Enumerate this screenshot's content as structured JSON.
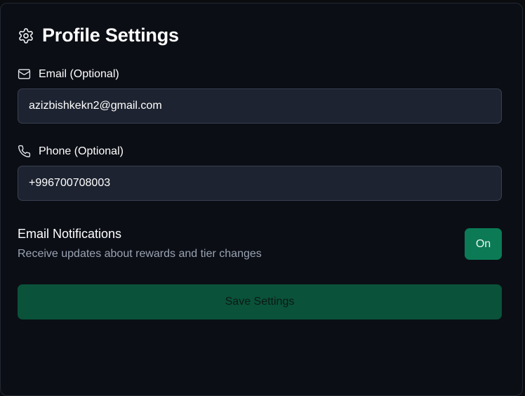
{
  "header": {
    "title": "Profile Settings",
    "icon": "gear-icon"
  },
  "email": {
    "label": "Email (Optional)",
    "icon": "mail-icon",
    "value": "azizbishkekn2@gmail.com"
  },
  "phone": {
    "label": "Phone (Optional)",
    "icon": "phone-icon",
    "value": "+996700708003"
  },
  "notifications": {
    "title": "Email Notifications",
    "description": "Receive updates about rewards and tier changes",
    "toggle_label": "On"
  },
  "actions": {
    "save_label": "Save Settings"
  },
  "colors": {
    "background": "#0b0e15",
    "input_bg": "#1d2330",
    "accent": "#0b7a55",
    "save_button": "#0a5239",
    "muted_text": "#9aa3b2"
  }
}
